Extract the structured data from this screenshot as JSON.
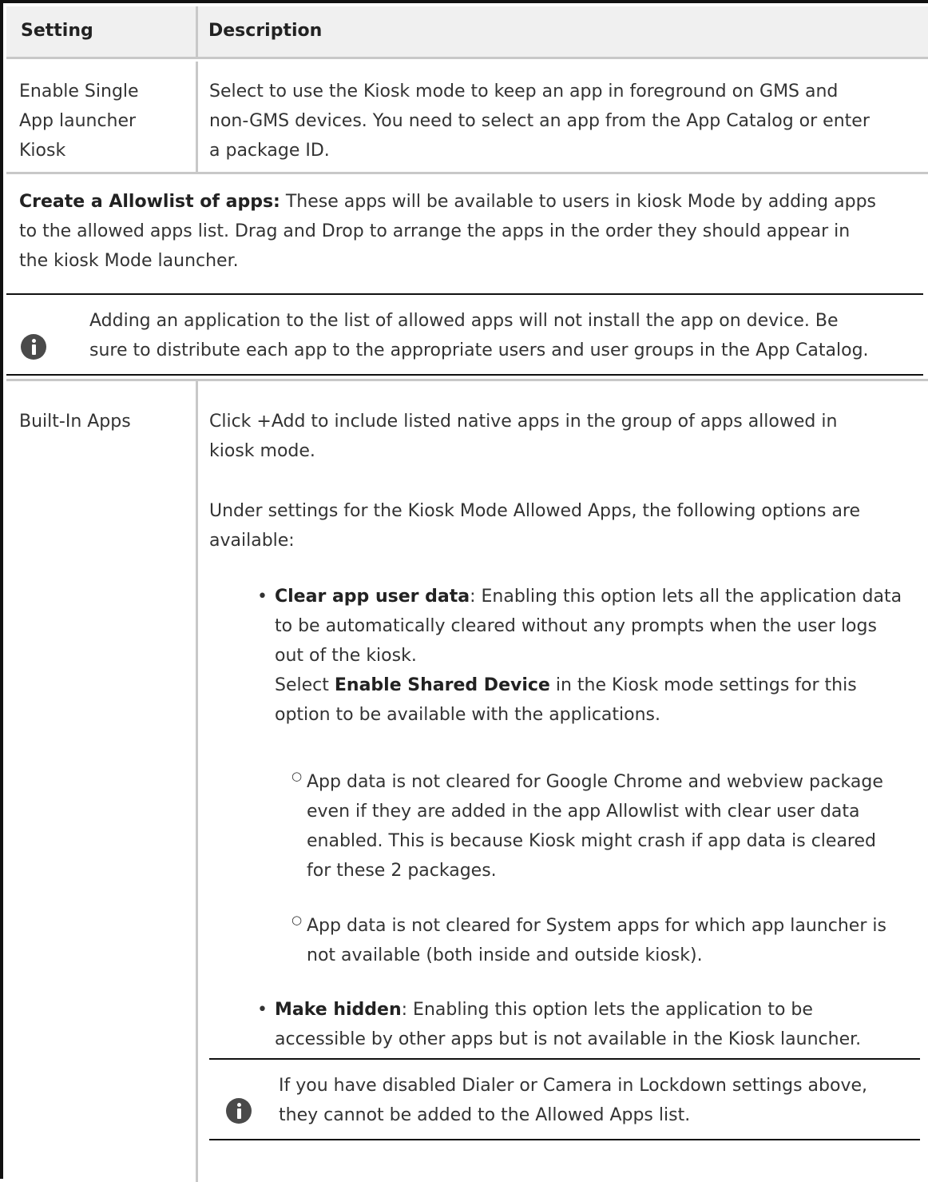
{
  "table": {
    "headers": [
      "Setting",
      "Description"
    ]
  },
  "row1": {
    "setting_lines": [
      "Enable Single",
      "App launcher",
      "Kiosk"
    ],
    "desc_lines": [
      "Select to use the Kiosk mode to keep an app in foreground on GMS and",
      "non-GMS devices. You need to select an app from the App Catalog or enter",
      "a package ID."
    ]
  },
  "allowlist": {
    "bold": "Create a Allowlist of apps:",
    "line1_rest": " These apps will be available to users in kiosk Mode by adding apps",
    "line2": "to the allowed apps list. Drag and Drop to arrange the apps in the order they should appear in",
    "line3": "the kiosk Mode launcher."
  },
  "note1": {
    "icon": "info-icon",
    "lines": [
      "Adding an application to the list of allowed apps will not install the app on device. Be",
      "sure to distribute each app to the appropriate users and user groups in the App Catalog."
    ]
  },
  "row2": {
    "setting": "Built-In Apps",
    "p1_lines": [
      "Click +Add to include listed native apps in the group of apps allowed in",
      "kiosk mode."
    ],
    "p2_lines": [
      "Under settings for the Kiosk Mode Allowed Apps, the following options are",
      "available:"
    ],
    "bullet1": {
      "bold": "Clear app user data",
      "rest": ": Enabling this option lets all the application data",
      "lines": [
        "to be automatically cleared without any prompts when the user logs",
        "out of the kiosk."
      ],
      "select_pre": "Select ",
      "select_bold": "Enable Shared Device",
      "select_post": " in the Kiosk mode settings for this",
      "select_line2": "option to be available with the applications."
    },
    "sub1_lines": [
      "App data is not cleared for Google Chrome and webview package",
      "even if they are added in the app Allowlist with clear user data",
      "enabled. This is because Kiosk might crash if app data is cleared",
      "for these 2 packages."
    ],
    "sub2_lines": [
      "App data is not cleared for System apps for which app launcher is",
      "not available (both inside and outside kiosk)."
    ],
    "bullet2": {
      "bold": "Make hidden",
      "rest": ": Enabling this option lets the application to be",
      "line2": "accessible by other apps but is not available in the Kiosk launcher."
    },
    "note2": {
      "icon": "info-icon",
      "lines": [
        "If you have disabled Dialer or Camera in Lockdown settings above,",
        "they cannot be added to the Allowed Apps list."
      ]
    }
  }
}
